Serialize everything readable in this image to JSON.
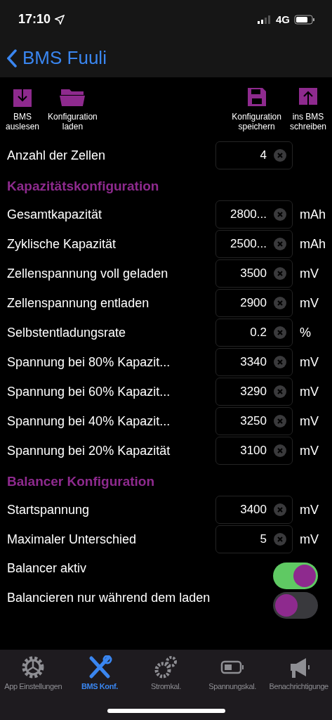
{
  "status_bar": {
    "time": "17:10",
    "network": "4G"
  },
  "nav": {
    "back_title": "BMS Fuuli"
  },
  "toolbar": [
    {
      "kind": "download",
      "label": "BMS\nauslesen"
    },
    {
      "kind": "folder",
      "label": "Konfiguration\nladen"
    },
    {
      "kind": "save",
      "label": "Konfiguration\nspeichern"
    },
    {
      "kind": "upload",
      "label": "ins BMS\nschreiben"
    }
  ],
  "sections": [
    {
      "rows": [
        {
          "kind": "field",
          "label": "Anzahl der Zellen",
          "value": "4"
        }
      ]
    },
    {
      "title": "Kapazitätskonfiguration",
      "rows": [
        {
          "kind": "field",
          "label": "Gesamtkapazität",
          "value": "2800...",
          "unit": "mAh"
        },
        {
          "kind": "field",
          "label": "Zyklische Kapazität",
          "value": "2500...",
          "unit": "mAh"
        },
        {
          "kind": "field",
          "label": "Zellenspannung voll geladen",
          "value": "3500",
          "unit": "mV"
        },
        {
          "kind": "field",
          "label": "Zellenspannung entladen",
          "value": "2900",
          "unit": "mV"
        },
        {
          "kind": "field",
          "label": "Selbstentladungsrate",
          "value": "0.2",
          "unit": "%"
        },
        {
          "kind": "field",
          "label": "Spannung bei 80% Kapazit...",
          "value": "3340",
          "unit": "mV"
        },
        {
          "kind": "field",
          "label": "Spannung bei 60% Kapazit...",
          "value": "3290",
          "unit": "mV"
        },
        {
          "kind": "field",
          "label": "Spannung bei 40% Kapazit...",
          "value": "3250",
          "unit": "mV"
        },
        {
          "kind": "field",
          "label": "Spannung bei 20% Kapazität",
          "value": "3100",
          "unit": "mV"
        }
      ]
    },
    {
      "title": "Balancer Konfiguration",
      "rows": [
        {
          "kind": "field",
          "label": "Startspannung",
          "value": "3400",
          "unit": "mV"
        },
        {
          "kind": "field",
          "label": "Maximaler Unterschied",
          "value": "5",
          "unit": "mV"
        },
        {
          "kind": "toggle",
          "label": "Balancer aktiv",
          "on": true
        },
        {
          "kind": "toggle",
          "label": "Balancieren nur während dem laden",
          "on": false
        }
      ]
    }
  ],
  "tab_bar": [
    {
      "kind": "gear",
      "label": "App Einstellungen",
      "selected": false
    },
    {
      "kind": "tools",
      "label": "BMS Konf.",
      "selected": true
    },
    {
      "kind": "gears",
      "label": "Stromkal.",
      "selected": false
    },
    {
      "kind": "battery",
      "label": "Spannungskal.",
      "selected": false
    },
    {
      "kind": "megaphone",
      "label": "Benachrichtigunge",
      "selected": false
    }
  ]
}
